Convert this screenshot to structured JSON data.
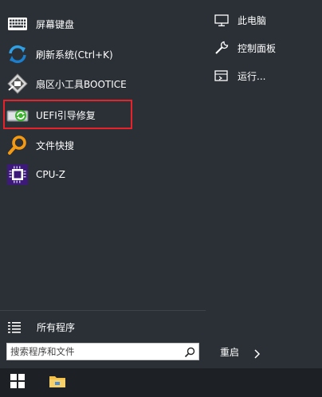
{
  "start_menu": {
    "apps": [
      {
        "label": "屏幕键盘",
        "icon": "keyboard-icon"
      },
      {
        "label": "刷新系统(Ctrl+K)",
        "icon": "refresh-icon"
      },
      {
        "label": "扇区小工具BOOTICE",
        "icon": "bootice-icon"
      },
      {
        "label": "UEFI引导修复",
        "icon": "uefi-repair-icon"
      },
      {
        "label": "文件快搜",
        "icon": "magnifier-icon"
      },
      {
        "label": "CPU-Z",
        "icon": "cpu-chip-icon"
      }
    ],
    "places": [
      {
        "label": "此电脑",
        "icon": "computer-icon"
      },
      {
        "label": "控制面板",
        "icon": "wrench-icon"
      },
      {
        "label": "运行...",
        "icon": "run-icon"
      }
    ],
    "all_programs_label": "所有程序",
    "search_placeholder": "搜索程序和文件",
    "power_label": "重启"
  },
  "taskbar": {
    "items": [
      {
        "icon": "windows-logo-icon"
      },
      {
        "icon": "file-explorer-icon"
      }
    ]
  },
  "colors": {
    "menu_bg": "#2b3036",
    "taskbar_bg": "#1d2024",
    "highlight": "#e8222a"
  }
}
